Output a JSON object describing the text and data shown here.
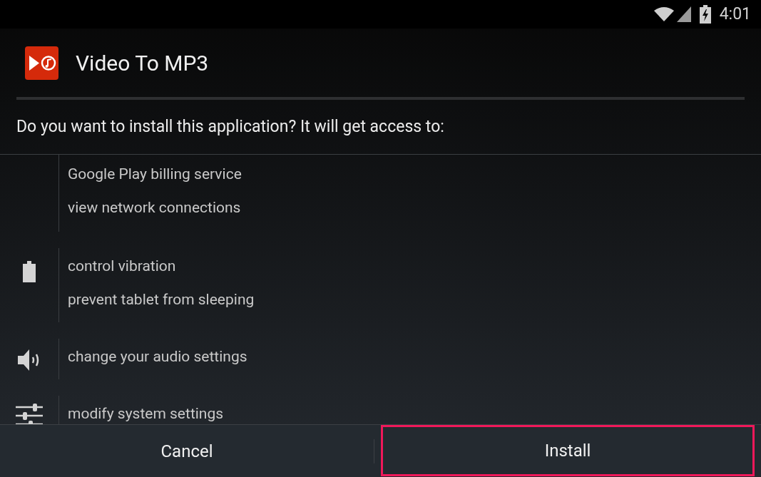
{
  "status_bar": {
    "time": "4:01"
  },
  "app": {
    "name": "Video To MP3"
  },
  "prompt": "Do you want to install this application? It will get access to:",
  "permission_groups": [
    {
      "kind": "none",
      "items": [
        "Google Play billing service",
        "view network connections"
      ]
    },
    {
      "kind": "battery",
      "items": [
        "control vibration",
        "prevent tablet from sleeping"
      ]
    },
    {
      "kind": "speaker",
      "items": [
        "change your audio settings"
      ]
    },
    {
      "kind": "sliders",
      "items": [
        "modify system settings"
      ]
    }
  ],
  "buttons": [
    {
      "label": "Cancel",
      "highlighted": false
    },
    {
      "label": "Install",
      "highlighted": true
    }
  ]
}
